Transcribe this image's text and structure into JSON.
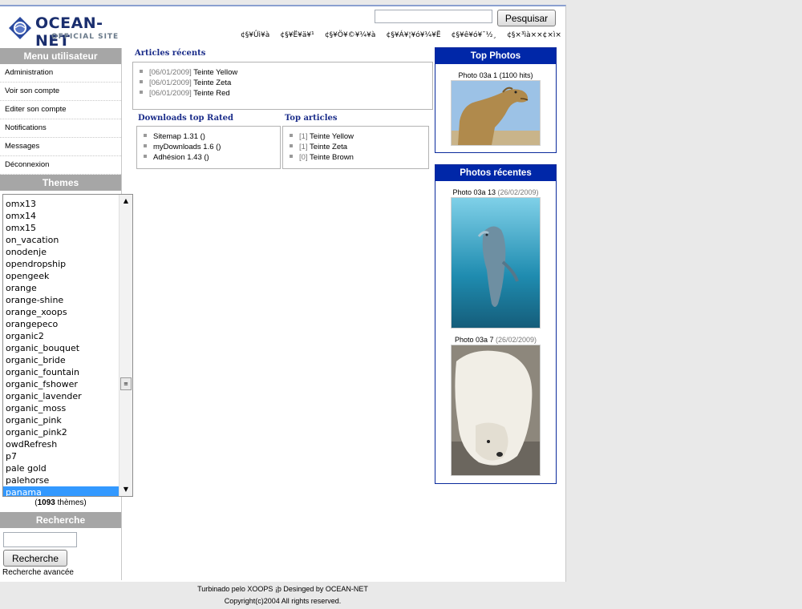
{
  "header": {
    "logo_title": "OCEAN-NET",
    "logo_sub": "OFFICIAL SITE",
    "search_button": "Pesquisar",
    "nav": [
      "¢§¥Ûì¥à",
      "¢§¥Ë¥ä¥¹",
      "¢§¥Ö¥©¥¼¥à",
      "¢§¥Á¥¦¥ó¥¼¥Ë",
      "¢§¥ê¥ó¥¯½¸",
      "¢§×³ìà××¢×ì×"
    ]
  },
  "usermenu": {
    "title": "Menu utilisateur",
    "items": [
      "Administration",
      "Voir son compte",
      "Editer son compte",
      "Notifications",
      "Messages",
      "Déconnexion"
    ]
  },
  "themes": {
    "title": "Themes",
    "items": [
      "omx13",
      "omx14",
      "omx15",
      "on_vacation",
      "onodenje",
      "opendropship",
      "opengeek",
      "orange",
      "orange-shine",
      "orange_xoops",
      "orangepeco",
      "organic2",
      "organic_bouquet",
      "organic_bride",
      "organic_fountain",
      "organic_fshower",
      "organic_lavender",
      "organic_moss",
      "organic_pink",
      "organic_pink2",
      "owdRefresh",
      "p7",
      "pale gold",
      "palehorse",
      "panama"
    ],
    "selected": "panama",
    "count_open": "(",
    "count": "1093",
    "count_close": " thèmes)"
  },
  "recherche": {
    "title": "Recherche",
    "button": "Recherche",
    "advanced": "Recherche avancée"
  },
  "articles_recents": {
    "title": "Articles récents",
    "items": [
      {
        "date": "[06/01/2009]",
        "name": "Teinte Yellow"
      },
      {
        "date": "[06/01/2009]",
        "name": "Teinte Zeta"
      },
      {
        "date": "[06/01/2009]",
        "name": "Teinte Red"
      }
    ]
  },
  "downloads": {
    "title": "Downloads top Rated",
    "items": [
      "Sitemap 1.31 ()",
      "myDownloads 1.6 ()",
      "Adhésion 1.43 ()"
    ]
  },
  "top_articles": {
    "title": "Top articles",
    "items": [
      {
        "count": "[1]",
        "name": "Teinte Yellow"
      },
      {
        "count": "[1]",
        "name": "Teinte Zeta"
      },
      {
        "count": "[0]",
        "name": "Teinte Brown"
      }
    ]
  },
  "top_photos": {
    "title": "Top Photos",
    "caption": "Photo 03a 1 (1100 hits)",
    "image": "camel"
  },
  "photos_recentes": {
    "title": "Photos récentes",
    "photos": [
      {
        "caption": "Photo 03a 13",
        "date": "(26/02/2009)",
        "image": "dolphin"
      },
      {
        "caption": "Photo 03a 7",
        "date": "(26/02/2009)",
        "image": "polar-bear"
      }
    ]
  },
  "footer": {
    "line1": "Turbinado pelo XOOPS ¡þ Desinged by OCEAN-NET",
    "line2": "Copyright(c)2004 All rights reserved."
  }
}
